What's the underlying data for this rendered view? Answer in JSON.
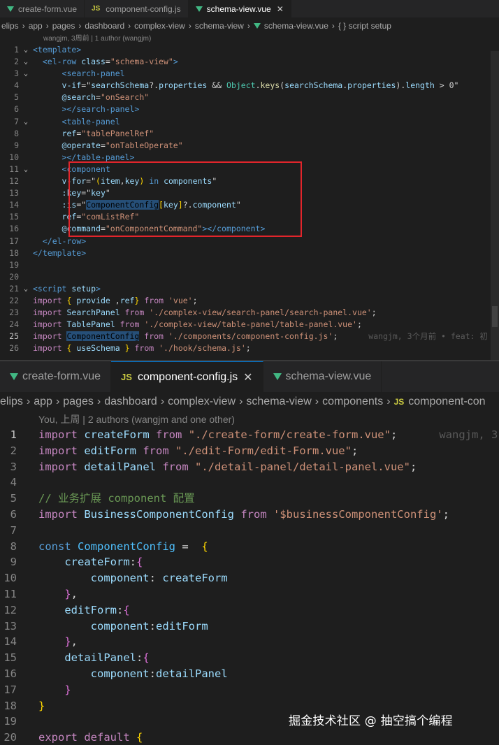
{
  "top": {
    "tabs": [
      {
        "label": "create-form.vue",
        "icon": "vue-icon",
        "active": false
      },
      {
        "label": "component-config.js",
        "icon": "js-icon",
        "icon_text": "JS",
        "active": false
      },
      {
        "label": "schema-view.vue",
        "icon": "vue-icon",
        "active": true,
        "close": "✕"
      }
    ],
    "breadcrumb": [
      "elips",
      "app",
      "pages",
      "dashboard",
      "complex-view",
      "schema-view",
      "schema-view.vue",
      "{ } script setup"
    ],
    "blame": "wangjm, 3周前 | 1 author (wangjm)",
    "inline_blame": "wangjm, 3个月前 • feat: 初",
    "current_line": 25,
    "lines": [
      {
        "n": 1,
        "fold": "⌄",
        "tokens": [
          [
            "t-tag",
            "<template>"
          ]
        ]
      },
      {
        "n": 2,
        "fold": "⌄",
        "tokens": [
          [
            "t-txt",
            "  "
          ],
          [
            "t-tag",
            "<el-row "
          ],
          [
            "t-attr",
            "class"
          ],
          [
            "t-txt",
            "="
          ],
          [
            "t-str",
            "\"schema-view\""
          ],
          [
            "t-tag",
            ">"
          ]
        ]
      },
      {
        "n": 3,
        "fold": "⌄",
        "tokens": [
          [
            "t-txt",
            "      "
          ],
          [
            "t-tag",
            "<search-panel"
          ]
        ]
      },
      {
        "n": 4,
        "fold": "",
        "tokens": [
          [
            "t-txt",
            "      "
          ],
          [
            "t-attr",
            "v-if"
          ],
          [
            "t-txt",
            "=\""
          ],
          [
            "t-var",
            "searchSchema"
          ],
          [
            "t-txt",
            "?."
          ],
          [
            "t-var",
            "properties"
          ],
          [
            "t-txt",
            " && "
          ],
          [
            "t-type",
            "Object"
          ],
          [
            "t-txt",
            "."
          ],
          [
            "t-fn",
            "keys"
          ],
          [
            "t-txt",
            "("
          ],
          [
            "t-var",
            "searchSchema"
          ],
          [
            "t-txt",
            "."
          ],
          [
            "t-var",
            "properties"
          ],
          [
            "t-txt",
            ")."
          ],
          [
            "t-var",
            "length"
          ],
          [
            "t-txt",
            " > 0\""
          ]
        ]
      },
      {
        "n": 5,
        "fold": "",
        "tokens": [
          [
            "t-txt",
            "      "
          ],
          [
            "t-attr",
            "@search"
          ],
          [
            "t-txt",
            "="
          ],
          [
            "t-str",
            "\"onSearch\""
          ]
        ]
      },
      {
        "n": 6,
        "fold": "",
        "tokens": [
          [
            "t-txt",
            "      "
          ],
          [
            "t-tag",
            "></search-panel>"
          ]
        ]
      },
      {
        "n": 7,
        "fold": "⌄",
        "tokens": [
          [
            "t-txt",
            "      "
          ],
          [
            "t-tag",
            "<table-panel"
          ]
        ]
      },
      {
        "n": 8,
        "fold": "",
        "tokens": [
          [
            "t-txt",
            "      "
          ],
          [
            "t-attr",
            "ref"
          ],
          [
            "t-txt",
            "="
          ],
          [
            "t-str",
            "\"tablePanelRef\""
          ]
        ]
      },
      {
        "n": 9,
        "fold": "",
        "tokens": [
          [
            "t-txt",
            "      "
          ],
          [
            "t-attr",
            "@operate"
          ],
          [
            "t-txt",
            "="
          ],
          [
            "t-str",
            "\"onTableOperate\""
          ]
        ]
      },
      {
        "n": 10,
        "fold": "",
        "tokens": [
          [
            "t-txt",
            "      "
          ],
          [
            "t-tag",
            "></table-panel>"
          ]
        ]
      },
      {
        "n": 11,
        "fold": "⌄",
        "tokens": [
          [
            "t-txt",
            "      "
          ],
          [
            "t-tag",
            "<component"
          ]
        ]
      },
      {
        "n": 12,
        "fold": "",
        "tokens": [
          [
            "t-txt",
            "      "
          ],
          [
            "t-attr",
            "v-for"
          ],
          [
            "t-txt",
            "=\""
          ],
          [
            "t-br1",
            "("
          ],
          [
            "t-var",
            "item"
          ],
          [
            "t-txt",
            ","
          ],
          [
            "t-var",
            "key"
          ],
          [
            "t-br1",
            ")"
          ],
          [
            "t-txt",
            " "
          ],
          [
            "t-kw2",
            "in"
          ],
          [
            "t-txt",
            " "
          ],
          [
            "t-var",
            "components"
          ],
          [
            "t-txt",
            "\""
          ]
        ]
      },
      {
        "n": 13,
        "fold": "",
        "tokens": [
          [
            "t-txt",
            "      "
          ],
          [
            "t-attr",
            ":key"
          ],
          [
            "t-txt",
            "=\""
          ],
          [
            "t-var",
            "key"
          ],
          [
            "t-txt",
            "\""
          ]
        ]
      },
      {
        "n": 14,
        "fold": "",
        "tokens": [
          [
            "t-txt",
            "      "
          ],
          [
            "t-attr",
            ":is"
          ],
          [
            "t-txt",
            "=\""
          ],
          [
            "hl",
            "ComponentConfig"
          ],
          [
            "t-br1",
            "["
          ],
          [
            "t-var",
            "key"
          ],
          [
            "t-br1",
            "]"
          ],
          [
            "t-txt",
            "?."
          ],
          [
            "t-var",
            "component"
          ],
          [
            "t-txt",
            "\""
          ]
        ]
      },
      {
        "n": 15,
        "fold": "",
        "tokens": [
          [
            "t-txt",
            "      "
          ],
          [
            "t-attr",
            "ref"
          ],
          [
            "t-txt",
            "="
          ],
          [
            "t-str",
            "\"comListRef\""
          ]
        ]
      },
      {
        "n": 16,
        "fold": "",
        "tokens": [
          [
            "t-txt",
            "      "
          ],
          [
            "t-attr",
            "@command"
          ],
          [
            "t-txt",
            "="
          ],
          [
            "t-str",
            "\"onComponentCommand\""
          ],
          [
            "t-tag",
            "></component>"
          ]
        ]
      },
      {
        "n": 17,
        "fold": "",
        "tokens": [
          [
            "t-txt",
            "  "
          ],
          [
            "t-tag",
            "</el-row>"
          ]
        ]
      },
      {
        "n": 18,
        "fold": "",
        "tokens": [
          [
            "t-tag",
            "</template>"
          ]
        ]
      },
      {
        "n": 19,
        "fold": "",
        "tokens": []
      },
      {
        "n": 20,
        "fold": "",
        "tokens": []
      },
      {
        "n": 21,
        "fold": "⌄",
        "tokens": [
          [
            "t-tag",
            "<script "
          ],
          [
            "t-attr",
            "setup"
          ],
          [
            "t-tag",
            ">"
          ]
        ]
      },
      {
        "n": 22,
        "fold": "",
        "tokens": [
          [
            "t-kw",
            "import"
          ],
          [
            "t-txt",
            " "
          ],
          [
            "t-br1",
            "{"
          ],
          [
            "t-txt",
            " "
          ],
          [
            "t-var",
            "provide"
          ],
          [
            "t-txt",
            " ,"
          ],
          [
            "t-var",
            "ref"
          ],
          [
            "t-br1",
            "}"
          ],
          [
            "t-txt",
            " "
          ],
          [
            "t-kw",
            "from"
          ],
          [
            "t-txt",
            " "
          ],
          [
            "t-str",
            "'vue'"
          ],
          [
            "t-txt",
            ";"
          ]
        ]
      },
      {
        "n": 23,
        "fold": "",
        "tokens": [
          [
            "t-kw",
            "import"
          ],
          [
            "t-txt",
            " "
          ],
          [
            "t-var",
            "SearchPanel"
          ],
          [
            "t-txt",
            " "
          ],
          [
            "t-kw",
            "from"
          ],
          [
            "t-txt",
            " "
          ],
          [
            "t-str",
            "'./complex-view/search-panel/search-panel.vue'"
          ],
          [
            "t-txt",
            ";"
          ]
        ]
      },
      {
        "n": 24,
        "fold": "",
        "tokens": [
          [
            "t-kw",
            "import"
          ],
          [
            "t-txt",
            " "
          ],
          [
            "t-var",
            "TablePanel"
          ],
          [
            "t-txt",
            " "
          ],
          [
            "t-kw",
            "from"
          ],
          [
            "t-txt",
            " "
          ],
          [
            "t-str",
            "'./complex-view/table-panel/table-panel.vue'"
          ],
          [
            "t-txt",
            ";"
          ]
        ]
      },
      {
        "n": 25,
        "fold": "",
        "tokens": [
          [
            "t-kw",
            "import"
          ],
          [
            "t-txt",
            " "
          ],
          [
            "hl",
            "ComponentConfig"
          ],
          [
            "t-txt",
            " "
          ],
          [
            "t-kw",
            "from"
          ],
          [
            "t-txt",
            " "
          ],
          [
            "t-str",
            "'./components/component-config.js'"
          ],
          [
            "t-txt",
            ";"
          ]
        ],
        "blame": true
      },
      {
        "n": 26,
        "fold": "",
        "tokens": [
          [
            "t-kw",
            "import"
          ],
          [
            "t-txt",
            " "
          ],
          [
            "t-br1",
            "{"
          ],
          [
            "t-txt",
            " "
          ],
          [
            "t-var",
            "useSchema"
          ],
          [
            "t-txt",
            " "
          ],
          [
            "t-br1",
            "}"
          ],
          [
            "t-txt",
            " "
          ],
          [
            "t-kw",
            "from"
          ],
          [
            "t-txt",
            " "
          ],
          [
            "t-str",
            "'./hook/schema.js'"
          ],
          [
            "t-txt",
            ";"
          ]
        ]
      }
    ]
  },
  "bottom": {
    "tabs": [
      {
        "label": "create-form.vue",
        "icon": "vue-icon",
        "active": false
      },
      {
        "label": "component-config.js",
        "icon": "js-icon",
        "icon_text": "JS",
        "active": true,
        "close": "✕"
      },
      {
        "label": "schema-view.vue",
        "icon": "vue-icon",
        "active": false
      }
    ],
    "breadcrumb": [
      "elips",
      "app",
      "pages",
      "dashboard",
      "complex-view",
      "schema-view",
      "components",
      "component-con"
    ],
    "blame": "You, 上周 | 2 authors (wangjm and one other)",
    "inline_blame": "wangjm, 3",
    "current_line": 1,
    "lines": [
      {
        "n": 1,
        "tokens": [
          [
            "t-kw",
            "import"
          ],
          [
            "t-txt",
            " "
          ],
          [
            "t-var",
            "createForm"
          ],
          [
            "t-txt",
            " "
          ],
          [
            "t-kw",
            "from"
          ],
          [
            "t-txt",
            " "
          ],
          [
            "t-str",
            "\"./create-form/create-form.vue\""
          ],
          [
            "t-txt",
            ";"
          ]
        ],
        "blame": true
      },
      {
        "n": 2,
        "tokens": [
          [
            "t-kw",
            "import"
          ],
          [
            "t-txt",
            " "
          ],
          [
            "t-var",
            "editForm"
          ],
          [
            "t-txt",
            " "
          ],
          [
            "t-kw",
            "from"
          ],
          [
            "t-txt",
            " "
          ],
          [
            "t-str",
            "\"./edit-Form/edit-Form.vue\""
          ],
          [
            "t-txt",
            ";"
          ]
        ]
      },
      {
        "n": 3,
        "tokens": [
          [
            "t-kw",
            "import"
          ],
          [
            "t-txt",
            " "
          ],
          [
            "t-var",
            "detailPanel"
          ],
          [
            "t-txt",
            " "
          ],
          [
            "t-kw",
            "from"
          ],
          [
            "t-txt",
            " "
          ],
          [
            "t-str",
            "\"./detail-panel/detail-panel.vue\""
          ],
          [
            "t-txt",
            ";"
          ]
        ]
      },
      {
        "n": 4,
        "tokens": []
      },
      {
        "n": 5,
        "tokens": [
          [
            "t-cmt",
            "// 业务扩展 component 配置"
          ]
        ]
      },
      {
        "n": 6,
        "tokens": [
          [
            "t-kw",
            "import"
          ],
          [
            "t-txt",
            " "
          ],
          [
            "t-var",
            "BusinessComponentConfig"
          ],
          [
            "t-txt",
            " "
          ],
          [
            "t-kw",
            "from"
          ],
          [
            "t-txt",
            " "
          ],
          [
            "t-str",
            "'$businessComponentConfig'"
          ],
          [
            "t-txt",
            ";"
          ]
        ]
      },
      {
        "n": 7,
        "tokens": []
      },
      {
        "n": 8,
        "tokens": [
          [
            "t-kw2",
            "const"
          ],
          [
            "t-txt",
            " "
          ],
          [
            "t-const",
            "ComponentConfig"
          ],
          [
            "t-txt",
            " =  "
          ],
          [
            "t-br1",
            "{"
          ]
        ]
      },
      {
        "n": 9,
        "tokens": [
          [
            "t-txt",
            "    "
          ],
          [
            "t-var",
            "createForm"
          ],
          [
            "t-txt",
            ":"
          ],
          [
            "t-br2",
            "{"
          ]
        ]
      },
      {
        "n": 10,
        "tokens": [
          [
            "t-txt",
            "        "
          ],
          [
            "t-var",
            "component"
          ],
          [
            "t-txt",
            ": "
          ],
          [
            "t-var",
            "createForm"
          ]
        ]
      },
      {
        "n": 11,
        "tokens": [
          [
            "t-txt",
            "    "
          ],
          [
            "t-br2",
            "}"
          ],
          [
            "t-txt",
            ","
          ]
        ]
      },
      {
        "n": 12,
        "tokens": [
          [
            "t-txt",
            "    "
          ],
          [
            "t-var",
            "editForm"
          ],
          [
            "t-txt",
            ":"
          ],
          [
            "t-br2",
            "{"
          ]
        ]
      },
      {
        "n": 13,
        "tokens": [
          [
            "t-txt",
            "        "
          ],
          [
            "t-var",
            "component"
          ],
          [
            "t-txt",
            ":"
          ],
          [
            "t-var",
            "editForm"
          ]
        ]
      },
      {
        "n": 14,
        "tokens": [
          [
            "t-txt",
            "    "
          ],
          [
            "t-br2",
            "}"
          ],
          [
            "t-txt",
            ","
          ]
        ]
      },
      {
        "n": 15,
        "tokens": [
          [
            "t-txt",
            "    "
          ],
          [
            "t-var",
            "detailPanel"
          ],
          [
            "t-txt",
            ":"
          ],
          [
            "t-br2",
            "{"
          ]
        ]
      },
      {
        "n": 16,
        "tokens": [
          [
            "t-txt",
            "        "
          ],
          [
            "t-var",
            "component"
          ],
          [
            "t-txt",
            ":"
          ],
          [
            "t-var",
            "detailPanel"
          ]
        ]
      },
      {
        "n": 17,
        "tokens": [
          [
            "t-txt",
            "    "
          ],
          [
            "t-br2",
            "}"
          ]
        ]
      },
      {
        "n": 18,
        "tokens": [
          [
            "t-br1",
            "}"
          ]
        ]
      },
      {
        "n": 19,
        "tokens": []
      },
      {
        "n": 20,
        "tokens": [
          [
            "t-kw",
            "export"
          ],
          [
            "t-txt",
            " "
          ],
          [
            "t-kw",
            "default"
          ],
          [
            "t-txt",
            " "
          ],
          [
            "t-br1",
            "{"
          ]
        ]
      }
    ]
  },
  "watermark": "掘金技术社区 @ 抽空搞个编程",
  "colors": {
    "highlight_box": "#e2252b",
    "vue_icon": "#41b883",
    "js_icon": "#cbcb41",
    "editor_bg": "#1e1e1e"
  }
}
